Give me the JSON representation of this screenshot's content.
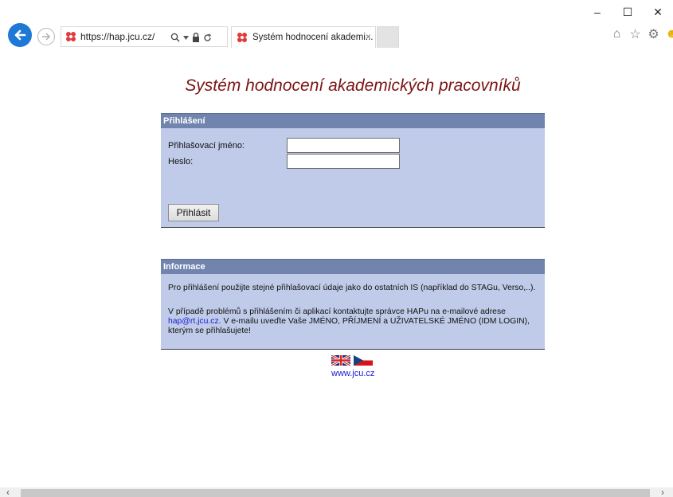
{
  "browser": {
    "url": "https://hap.jcu.cz/",
    "tab_title": "Systém hodnocení akademi...",
    "tab_close": "×",
    "win_minimize": "–",
    "win_maximize": "☐",
    "win_close": "✕"
  },
  "page": {
    "title": "Systém hodnocení akademických pracovníků"
  },
  "login": {
    "header": "Přihlášení",
    "username_label": "Přihlašovací jméno:",
    "username_value": "",
    "password_label": "Heslo:",
    "password_value": "",
    "submit_label": "Přihlásit"
  },
  "info": {
    "header": "Informace",
    "paragraph1": "Pro přihlášení použijte stejné přihlašovací údaje jako do ostatních IS (například do STAGu, Verso,..).",
    "paragraph2_prefix": "V případě problémů s přihlášením či aplikací kontaktujte správce HAPu na e-mailové adrese",
    "email": "hap@rt.jcu.cz.",
    "paragraph2_suffix": " V e-mailu uveďte Vaše JMÉNO, PŘÍJMENÍ a UŽIVATELSKÉ JMÉNO (IDM LOGIN), kterým se přihlašujete!"
  },
  "footer": {
    "link": "www.jcu.cz"
  },
  "icons": {
    "back": "back-arrow-icon",
    "forward": "forward-arrow-icon",
    "home": "home-icon",
    "favorites": "star-icon",
    "settings": "gear-icon",
    "feedback": "smiley-icon"
  },
  "colors": {
    "title": "#7b1313",
    "panel_header": "#7184ae",
    "panel_body": "#bfcbe8",
    "link": "#1a1ad9"
  }
}
